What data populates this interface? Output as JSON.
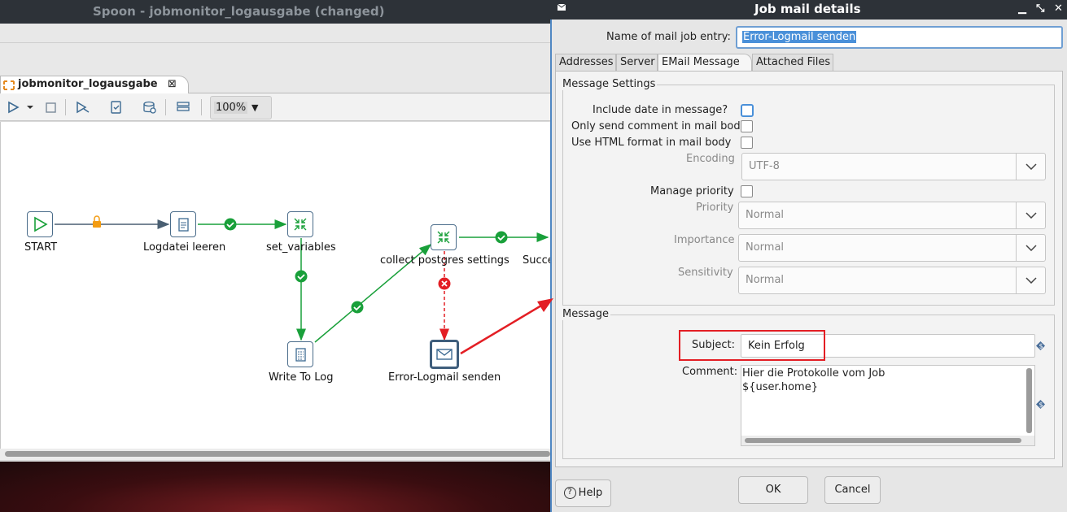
{
  "spoon": {
    "title": "Spoon - jobmonitor_logausgabe (changed)",
    "tab_label": "jobmonitor_logausgabe",
    "tab_close": "⊠",
    "zoom": "100%",
    "nodes": {
      "start": "START",
      "logdatei": "Logdatei leeren",
      "set_variables": "set_variables",
      "collect": "collect postgres settings",
      "success": "Succe",
      "write_log": "Write To Log",
      "error_mail": "Error-Logmail senden"
    }
  },
  "dialog": {
    "title": "Job mail details",
    "name_label": "Name of mail job entry:",
    "name_value": "Error-Logmail senden",
    "tabs": [
      "Addresses",
      "Server",
      "EMail Message",
      "Attached Files"
    ],
    "active_tab": "EMail Message",
    "message_settings": {
      "title": "Message Settings",
      "include_date": "Include date in message?",
      "only_comment": "Only send comment in mail body",
      "html_format": "Use HTML format in mail body",
      "encoding_label": "Encoding",
      "encoding_value": "UTF-8",
      "manage_priority": "Manage priority",
      "priority_label": "Priority",
      "priority_value": "Normal",
      "importance_label": "Importance",
      "importance_value": "Normal",
      "sensitivity_label": "Sensitivity",
      "sensitivity_value": "Normal"
    },
    "message": {
      "title": "Message",
      "subject_label": "Subject:",
      "subject_value": "Kein Erfolg",
      "comment_label": "Comment:",
      "comment_value": "Hier die Protokolle vom Job\n${user.home}"
    },
    "buttons": {
      "help": "Help",
      "ok": "OK",
      "cancel": "Cancel"
    }
  },
  "colors": {
    "hop_green": "#19a03a",
    "hop_red": "#e31e24",
    "hop_dark": "#4a5f72",
    "annotation_red": "#e31e24",
    "titlebar": "#2d3238",
    "accent_blue": "#4a90d9"
  }
}
